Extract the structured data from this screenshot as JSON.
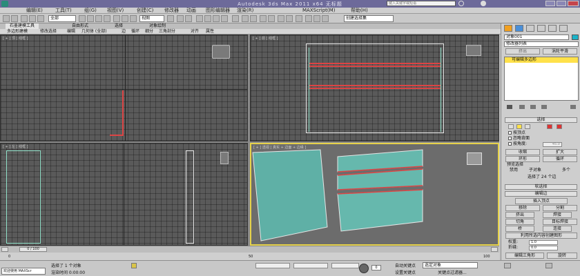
{
  "window": {
    "title": "Autodesk 3ds Max 2011 x64    无标题",
    "search_placeholder": "键入关键字或短语"
  },
  "menu": [
    "编辑(E)",
    "工具(T)",
    "组(G)",
    "视图(V)",
    "创建(C)",
    "修改器",
    "动画",
    "图形编辑器",
    "渲染(R)",
    "MAXScript(M)",
    "帮助(H)"
  ],
  "toolbar": {
    "filter": "全部",
    "ref_coord": "视图",
    "selection_set": "创建选择集"
  },
  "ribbon": {
    "tabs": [
      "石墨建模工具",
      "自由形式",
      "选择",
      "对象绘制"
    ],
    "tools": [
      "多边形建模",
      "修改选择",
      "编辑",
      "几何体 (全部)",
      "边",
      "循环",
      "细分",
      "三角剖分",
      "对齐",
      "属性"
    ]
  },
  "viewports": {
    "top_left": "[ + ] 顶 [ 线框 ]",
    "top_right": "[ + ] 前 [ 线框 ]",
    "bottom_left": "[ + ] 左 [ 线框 ]",
    "bottom_right": "[ + ] 透视 [ 真实 + 边面 + 边缘 ]"
  },
  "time_slider": {
    "label": "0 / 100"
  },
  "trackbar_ticks": [
    "0",
    "5",
    "10",
    "15",
    "20",
    "25",
    "30",
    "35",
    "40",
    "45",
    "50",
    "55",
    "60",
    "65",
    "70",
    "75",
    "80",
    "85",
    "90",
    "95",
    "100"
  ],
  "status": {
    "welcome": "欢迎使用 MAXScr",
    "selected": "选择了 1 个对象",
    "render_time": "渲染时间 0:00:00",
    "auto_key": "自动关键点",
    "set_key": "设置关键点",
    "key_mode": "选定对象",
    "key_filter": "关键点过滤器...",
    "frame": "0"
  },
  "panel": {
    "object_name": "对象001",
    "modifier_list": "修改器列表",
    "btn_extrude": "挤出",
    "btn_turbosmooth": "涡轮平滑",
    "stack_item": "可编辑多边形",
    "selection_header": "选择",
    "by_vertex": "按顶点",
    "ignore_backfacing": "忽略背面",
    "by_angle": "按角度:",
    "angle_value": "45.0",
    "shrink": "收缩",
    "grow": "扩大",
    "ring": "环形",
    "loop": "循环",
    "preview_selection": "预览选择",
    "disabled": "禁用",
    "sub_object": "子对象",
    "multi": "多个",
    "selected_count": "选择了 24 个边",
    "soft_selection": "软选择",
    "edit_edges": "编辑边",
    "insert_vertex": "插入顶点",
    "remove": "移除",
    "split": "分割",
    "extrude": "挤出",
    "weld": "焊接",
    "chamfer": "切角",
    "target_weld": "目标焊接",
    "bridge": "桥",
    "connect": "连接",
    "create_shape": "利用所选内容创建图形",
    "weight_label": "权重:",
    "weight_value": "1.0",
    "crease_label": "折缝:",
    "crease_value": "0.0",
    "edit_tri": "编辑三角形",
    "rotate": "旋转"
  }
}
